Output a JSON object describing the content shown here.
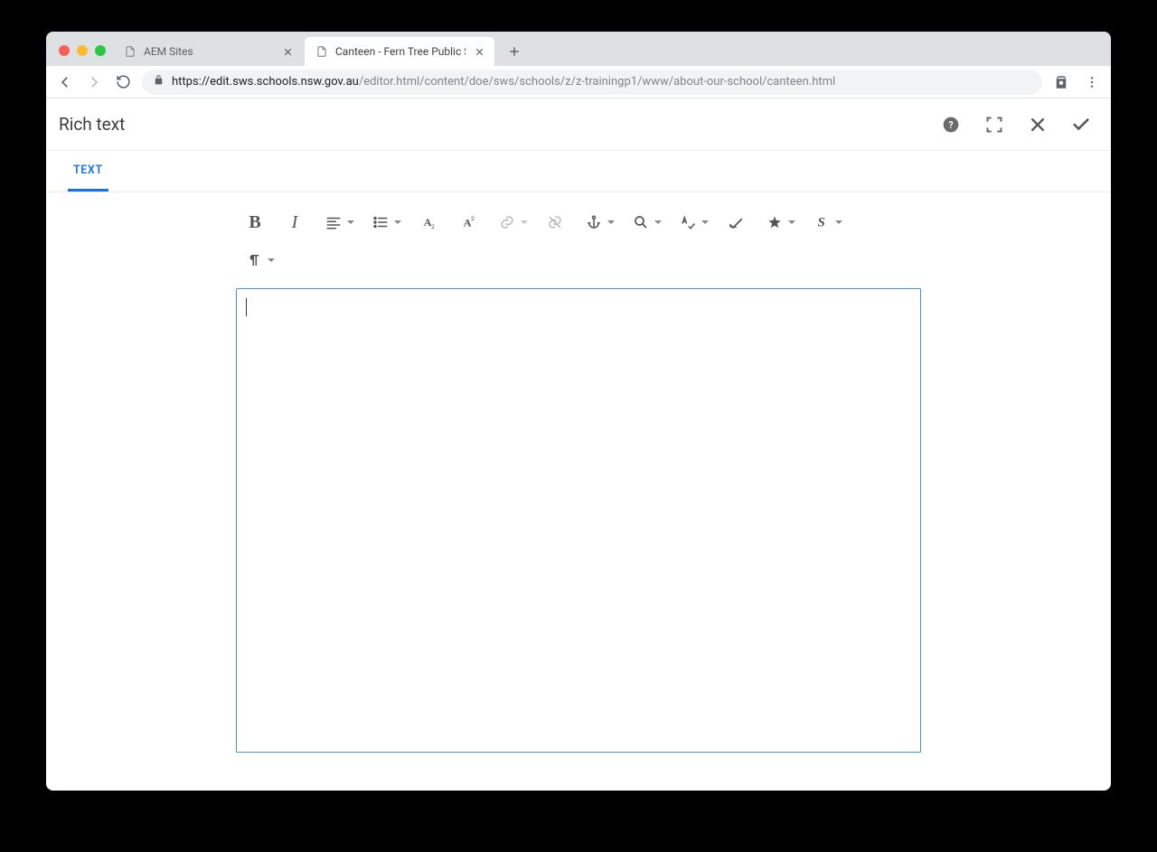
{
  "browser": {
    "tabs": [
      {
        "title": "AEM Sites",
        "active": false
      },
      {
        "title": "Canteen - Fern Tree Public Sch",
        "active": true
      }
    ],
    "url_host": "https://edit.sws.schools.nsw.gov.au",
    "url_path": "/editor.html/content/doe/sws/schools/z/z-trainingp1/www/about-our-school/canteen.html"
  },
  "dialog": {
    "title": "Rich text",
    "tab_label": "TEXT",
    "editor_value": ""
  },
  "toolbar": {
    "bold": "B",
    "italic": "I"
  }
}
